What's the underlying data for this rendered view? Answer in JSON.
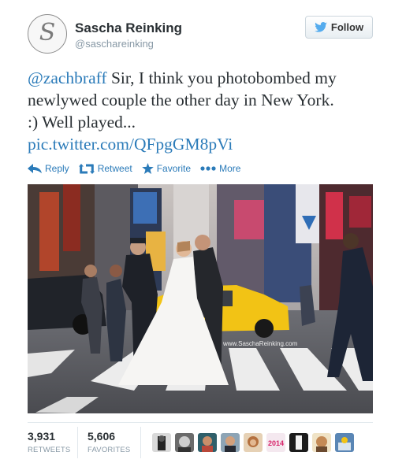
{
  "author": {
    "name": "Sascha Reinking",
    "handle": "@saschareinking",
    "avatar_letter": "S"
  },
  "follow_button": {
    "label": "Follow",
    "icon": "twitter-bird-icon",
    "color": "#2b7bb9"
  },
  "tweet": {
    "mention": "@zachbraff",
    "line1_rest": " Sir, I think you photobombed my",
    "line2": "newlywed couple the other day in New York.",
    "line3": ":) Well played...",
    "link": "pic.twitter.com/QFpgGM8pVi"
  },
  "actions": [
    {
      "label": "Reply",
      "icon": "reply-arrow-icon"
    },
    {
      "label": "Retweet",
      "icon": "retweet-icon"
    },
    {
      "label": "Favorite",
      "icon": "star-icon"
    },
    {
      "label": "More",
      "icon": "more-dots-icon"
    }
  ],
  "photo": {
    "watermark": "www.SaschaReinking.com"
  },
  "stats": {
    "retweets": {
      "count": "3,931",
      "label": "RETWEETS"
    },
    "favorites": {
      "count": "5,606",
      "label": "FAVORITES"
    }
  },
  "favoriter_avatars": [
    {
      "name": "favoriter-avatar-1"
    },
    {
      "name": "favoriter-avatar-2"
    },
    {
      "name": "favoriter-avatar-3"
    },
    {
      "name": "favoriter-avatar-4"
    },
    {
      "name": "favoriter-avatar-5"
    },
    {
      "name": "favoriter-avatar-6",
      "text": "2014"
    },
    {
      "name": "favoriter-avatar-7"
    },
    {
      "name": "favoriter-avatar-8"
    },
    {
      "name": "favoriter-avatar-9"
    }
  ],
  "colors": {
    "link": "#2b7bb9",
    "text": "#292f33",
    "muted": "#8899a6",
    "taxi": "#f2c315"
  }
}
